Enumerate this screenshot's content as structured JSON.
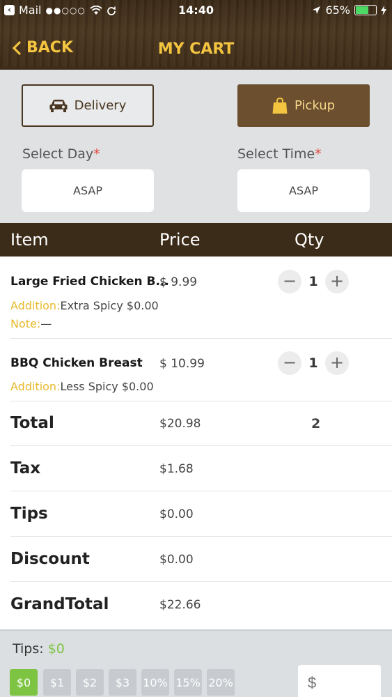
{
  "status_bar": {
    "back_app": "Mail",
    "signal_dots": "●●○○○",
    "wifi_icon": "wifi-icon",
    "time": "14:40",
    "battery_percent": "65%",
    "battery_level": 0.65
  },
  "nav": {
    "back_label": "BACK",
    "title": "MY CART"
  },
  "order_mode": {
    "delivery_label": "Delivery",
    "pickup_label": "Pickup",
    "selected": "pickup"
  },
  "schedule": {
    "day_label": "Select Day",
    "day_value": "ASAP",
    "time_label": "Select Time",
    "time_value": "ASAP",
    "required_mark": "*"
  },
  "table": {
    "col_item": "Item",
    "col_price": "Price",
    "col_qty": "Qty"
  },
  "items": [
    {
      "name": "Large Fried Chicken B...",
      "price": "$ 9.99",
      "qty": "1",
      "addition_label": "Addition:",
      "addition_value": "Extra Spicy $0.00",
      "note_label": "Note:",
      "note_value": "—"
    },
    {
      "name": "BBQ Chicken Breast",
      "price": "$ 10.99",
      "qty": "1",
      "addition_label": "Addition:",
      "addition_value": "Less Spicy $0.00"
    }
  ],
  "summary": {
    "total_label": "Total",
    "total_value": "$20.98",
    "total_qty": "2",
    "tax_label": "Tax",
    "tax_value": "$1.68",
    "tips_label": "Tips",
    "tips_value": "$0.00",
    "discount_label": "Discount",
    "discount_value": "$0.00",
    "grand_label": "GrandTotal",
    "grand_value": "$22.66"
  },
  "tips": {
    "title": "Tips:",
    "amount": "$0",
    "options": [
      "$0",
      "$1",
      "$2",
      "$3",
      "10%",
      "15%",
      "20%"
    ],
    "selected_index": 0,
    "custom_placeholder": "$"
  },
  "colors": {
    "accent_gold": "#f2c440",
    "header_brown": "#3b2b19",
    "pickup_brown": "#6b4f2e",
    "addition_label": "#e7b92d",
    "tip_green": "#7cc441",
    "required_red": "#e0463a"
  }
}
